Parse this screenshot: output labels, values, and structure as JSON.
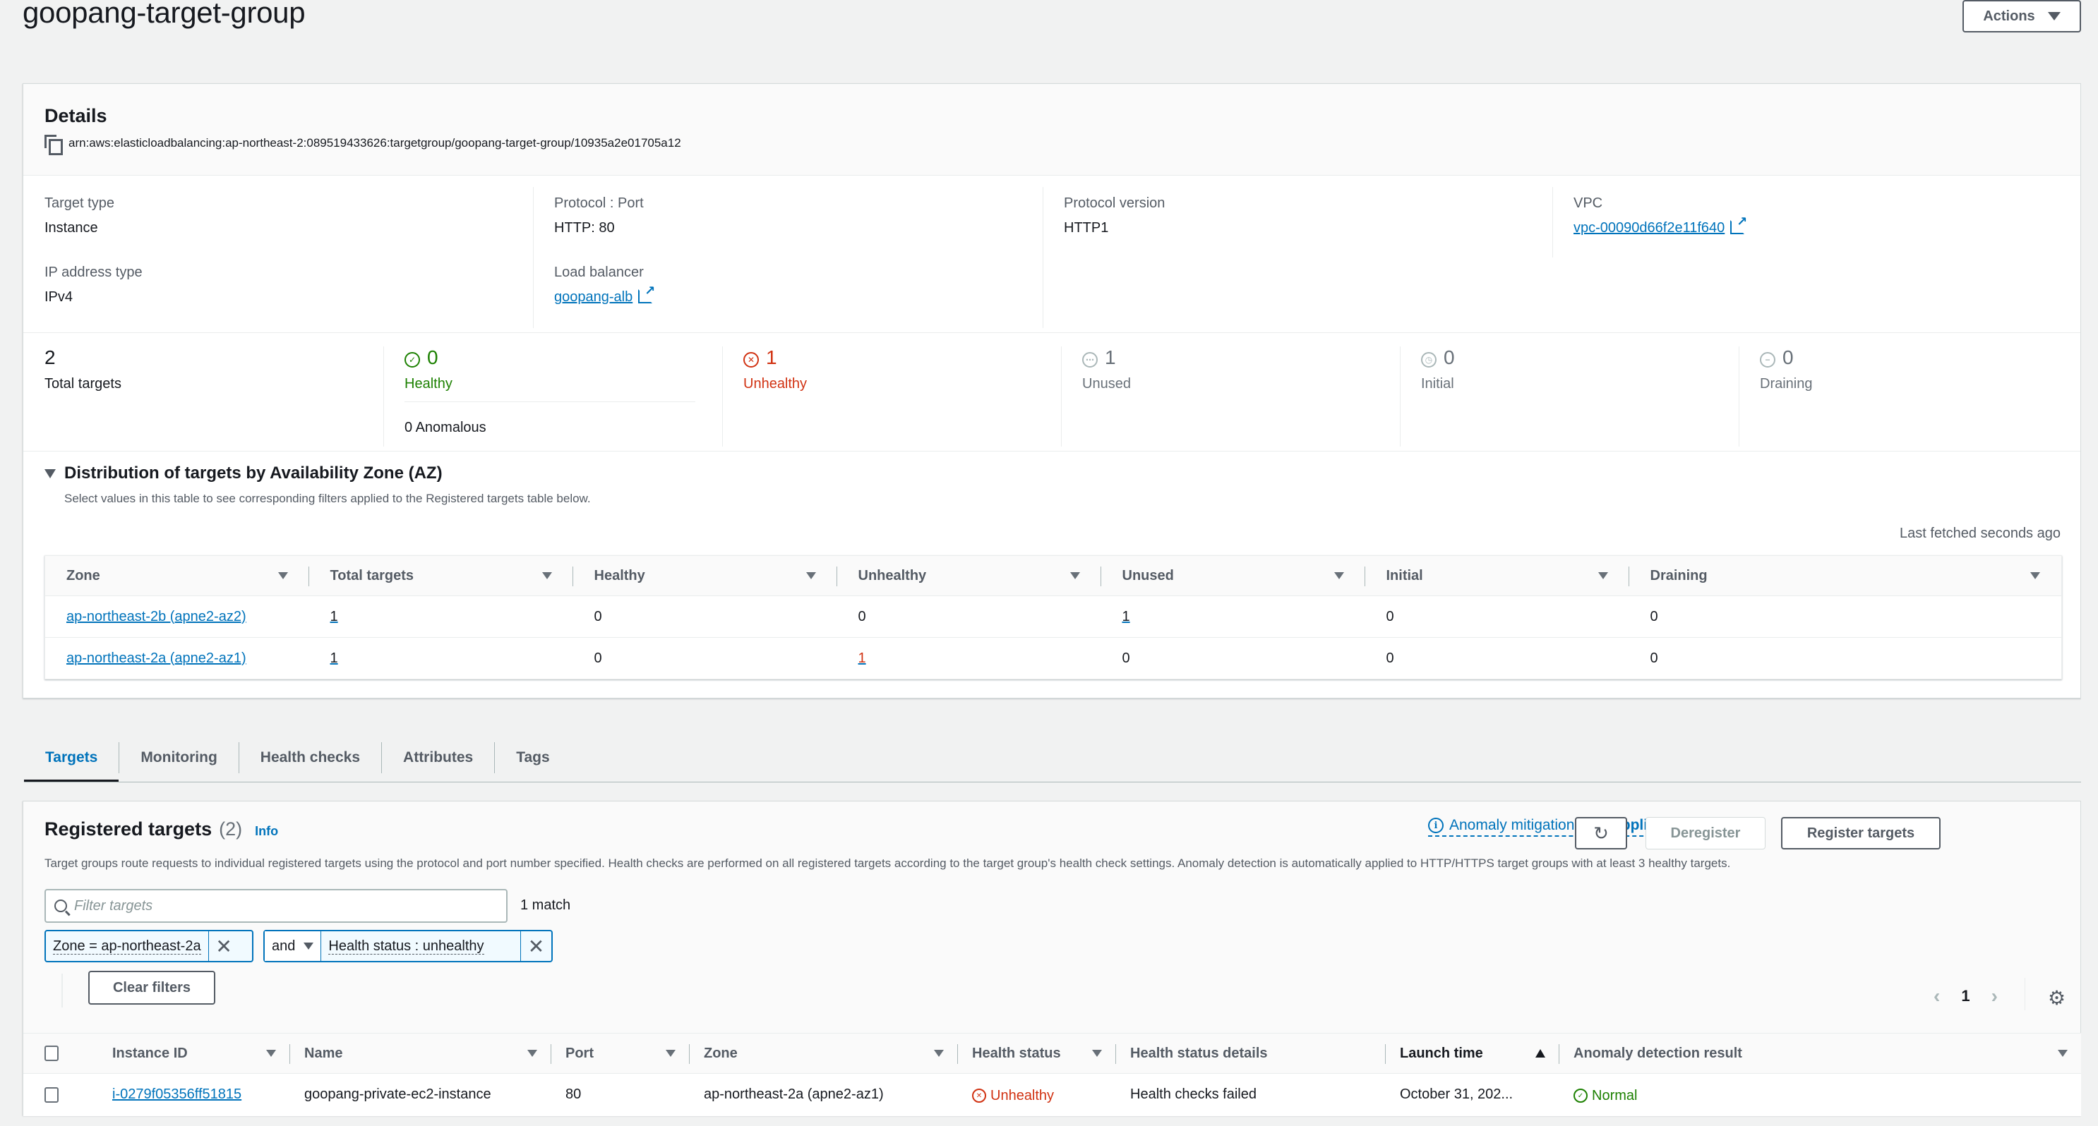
{
  "page": {
    "title": "goopang-target-group",
    "actions_label": "Actions"
  },
  "details": {
    "heading": "Details",
    "arn": "arn:aws:elasticloadbalancing:ap-northeast-2:089519433626:targetgroup/goopang-target-group/10935a2e01705a12",
    "properties": {
      "target_type_label": "Target type",
      "target_type_value": "Instance",
      "ip_type_label": "IP address type",
      "ip_type_value": "IPv4",
      "protocol_port_label": "Protocol : Port",
      "protocol_port_value": "HTTP: 80",
      "load_balancer_label": "Load balancer",
      "load_balancer_value": "goopang-alb",
      "protocol_version_label": "Protocol version",
      "protocol_version_value": "HTTP1",
      "vpc_label": "VPC",
      "vpc_value": "vpc-00090d66f2e11f640"
    },
    "counts": {
      "total_value": "2",
      "total_label": "Total targets",
      "healthy_value": "0",
      "healthy_label": "Healthy",
      "anomalous_label": "0 Anomalous",
      "unhealthy_value": "1",
      "unhealthy_label": "Unhealthy",
      "unused_value": "1",
      "unused_label": "Unused",
      "initial_value": "0",
      "initial_label": "Initial",
      "draining_value": "0",
      "draining_label": "Draining"
    },
    "colors": {
      "healthy": "#1d8102",
      "unhealthy": "#d13212",
      "link": "#0073bb"
    }
  },
  "distribution": {
    "title": "Distribution of targets by Availability Zone (AZ)",
    "subtitle": "Select values in this table to see corresponding filters applied to the Registered targets table below.",
    "last_fetched": "Last fetched seconds ago",
    "columns": [
      "Zone",
      "Total targets",
      "Healthy",
      "Unhealthy",
      "Unused",
      "Initial",
      "Draining"
    ],
    "rows": [
      {
        "zone": "ap-northeast-2b (apne2-az2)",
        "total": "1",
        "healthy": "0",
        "unhealthy": "0",
        "unused": "1",
        "initial": "0",
        "draining": "0"
      },
      {
        "zone": "ap-northeast-2a (apne2-az1)",
        "total": "1",
        "healthy": "0",
        "unhealthy": "1",
        "unused": "0",
        "initial": "0",
        "draining": "0"
      }
    ]
  },
  "tabs": [
    {
      "label": "Targets",
      "active": true
    },
    {
      "label": "Monitoring",
      "active": false
    },
    {
      "label": "Health checks",
      "active": false
    },
    {
      "label": "Attributes",
      "active": false
    },
    {
      "label": "Tags",
      "active": false
    }
  ],
  "registered": {
    "title": "Registered targets",
    "count": "(2)",
    "info": "Info",
    "description": "Target groups route requests to individual registered targets using the protocol and port number specified. Health checks are performed on all registered targets according to the target group's health check settings. Anomaly detection is automatically applied to HTTP/HTTPS target groups with at least 3 healthy targets.",
    "anomaly_label": "Anomaly mitigation:",
    "anomaly_value": "Not applicable",
    "deregister_label": "Deregister",
    "register_label": "Register targets",
    "filter_placeholder": "Filter targets",
    "match_count": "1 match",
    "filter_token_1": "Zone = ap-northeast-2a",
    "filter_operator": "and",
    "filter_token_2": "Health status : unhealthy",
    "clear_filters": "Clear filters",
    "current_page": "1",
    "columns": [
      "Instance ID",
      "Name",
      "Port",
      "Zone",
      "Health status",
      "Health status details",
      "Launch time",
      "Anomaly detection result"
    ],
    "rows": [
      {
        "instance_id": "i-0279f05356ff51815",
        "name": "goopang-private-ec2-instance",
        "port": "80",
        "zone": "ap-northeast-2a (apne2-az1)",
        "health_status": "Unhealthy",
        "health_details": "Health checks failed",
        "launch_time": "October 31, 202...",
        "anomaly_result": "Normal"
      }
    ]
  }
}
